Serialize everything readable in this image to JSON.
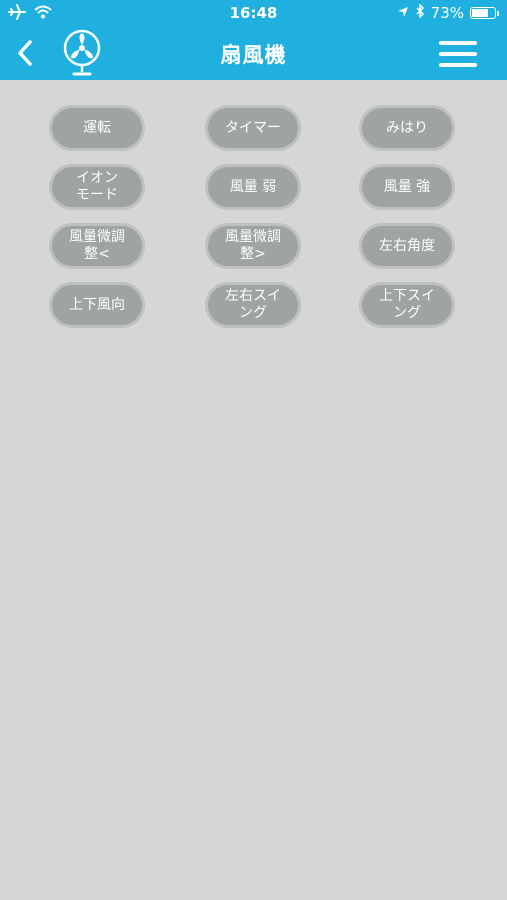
{
  "status_bar": {
    "time": "16:48",
    "battery": "73%",
    "battery_level": 0.73
  },
  "header": {
    "title": "扇風機"
  },
  "buttons": [
    {
      "label": "運転"
    },
    {
      "label": "タイマー"
    },
    {
      "label": "みはり"
    },
    {
      "label": "イオン\nモード"
    },
    {
      "label": "風量 弱"
    },
    {
      "label": "風量 強"
    },
    {
      "label": "風量微調\n整<"
    },
    {
      "label": "風量微調\n整>"
    },
    {
      "label": "左右角度"
    },
    {
      "label": "上下風向"
    },
    {
      "label": "左右スイ\nング"
    },
    {
      "label": "上下スイ\nング"
    }
  ],
  "colors": {
    "header_bg": "#1fb0e0",
    "page_bg": "#d6d6d6",
    "button_bg": "#9ea3a3"
  }
}
